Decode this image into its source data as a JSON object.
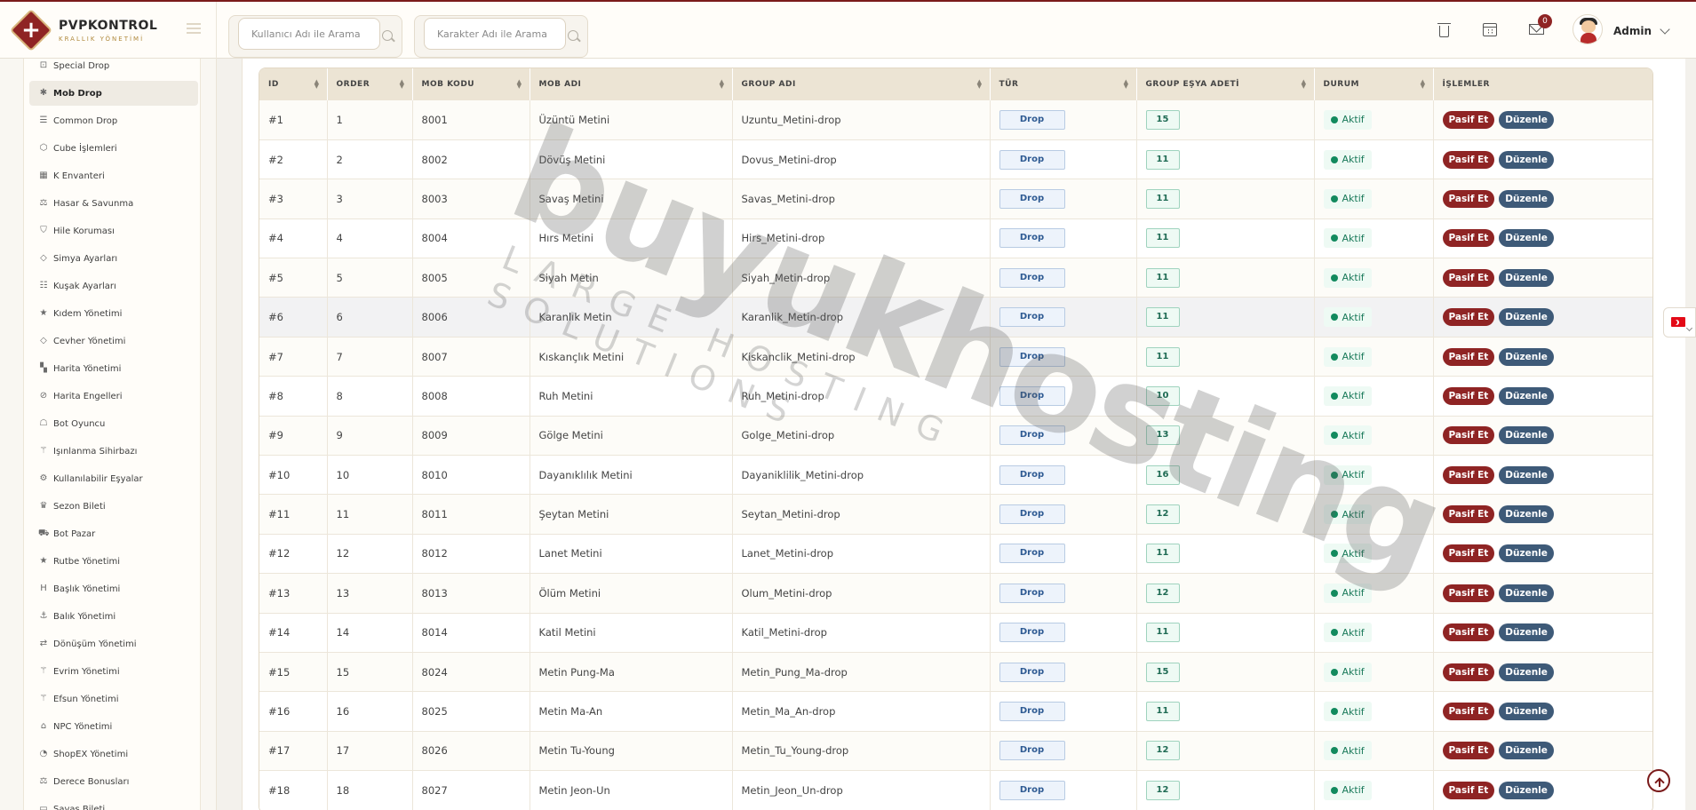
{
  "brand": {
    "title": "PVPKONTROL",
    "subtitle": "KRALLIK YÖNETİMİ"
  },
  "header": {
    "search_user_placeholder": "Kullanıcı Adı ile Arama",
    "search_char_placeholder": "Karakter Adı ile Arama",
    "notification_count": "0",
    "user_name": "Admin"
  },
  "sidebar": {
    "items": [
      {
        "label": "Special Drop",
        "icon": "gift-icon",
        "glyph": "⊡"
      },
      {
        "label": "Mob Drop",
        "icon": "bug-icon",
        "glyph": "✱",
        "active": true
      },
      {
        "label": "Common Drop",
        "icon": "list-icon",
        "glyph": "☰"
      },
      {
        "label": "Cube İşlemleri",
        "icon": "cube-icon",
        "glyph": "⬡"
      },
      {
        "label": "K Envanteri",
        "icon": "grid-icon",
        "glyph": "▦"
      },
      {
        "label": "Hasar & Savunma",
        "icon": "scale-icon",
        "glyph": "⚖"
      },
      {
        "label": "Hile Koruması",
        "icon": "shield-icon",
        "glyph": "⛉"
      },
      {
        "label": "Simya Ayarları",
        "icon": "gem-icon",
        "glyph": "◇"
      },
      {
        "label": "Kuşak Ayarları",
        "icon": "sliders-icon",
        "glyph": "☷"
      },
      {
        "label": "Kıdem Yönetimi",
        "icon": "star-icon",
        "glyph": "★"
      },
      {
        "label": "Cevher Yönetimi",
        "icon": "gem-icon",
        "glyph": "◇"
      },
      {
        "label": "Harita Yönetimi",
        "icon": "map-icon",
        "glyph": "▚"
      },
      {
        "label": "Harita Engelleri",
        "icon": "ban-icon",
        "glyph": "⊘"
      },
      {
        "label": "Bot Oyuncu",
        "icon": "robot-icon",
        "glyph": "☖"
      },
      {
        "label": "Işınlanma Sihirbazı",
        "icon": "wand-icon",
        "glyph": "⚚"
      },
      {
        "label": "Kullanılabilir Eşyalar",
        "icon": "gears-icon",
        "glyph": "⚙"
      },
      {
        "label": "Sezon Bileti",
        "icon": "trophy-icon",
        "glyph": "♛"
      },
      {
        "label": "Bot Pazar",
        "icon": "cart-icon",
        "glyph": "⛟"
      },
      {
        "label": "Rutbe Yönetimi",
        "icon": "star-icon",
        "glyph": "★"
      },
      {
        "label": "Başlık Yönetimi",
        "icon": "heading-icon",
        "glyph": "H"
      },
      {
        "label": "Balık Yönetimi",
        "icon": "anchor-icon",
        "glyph": "⚓"
      },
      {
        "label": "Dönüşüm Yönetimi",
        "icon": "shuffle-icon",
        "glyph": "⇄"
      },
      {
        "label": "Evrim Yönetimi",
        "icon": "wand-icon",
        "glyph": "⚚"
      },
      {
        "label": "Efsun Yönetimi",
        "icon": "wand-icon",
        "glyph": "⚚"
      },
      {
        "label": "NPC Yönetimi",
        "icon": "building-icon",
        "glyph": "⌂"
      },
      {
        "label": "ShopEX Yönetimi",
        "icon": "gauge-icon",
        "glyph": "◔"
      },
      {
        "label": "Derece Bonusları",
        "icon": "scale-icon",
        "glyph": "⚖"
      },
      {
        "label": "Savaş Bileti",
        "icon": "ticket-icon",
        "glyph": "▭"
      }
    ]
  },
  "table": {
    "columns": [
      "ID",
      "ORDER",
      "MOB KODU",
      "MOB ADI",
      "GROUP ADI",
      "TÜR",
      "GROUP EŞYA ADETİ",
      "DURUM",
      "İŞLEMLER"
    ],
    "action_pasif": "Pasif Et",
    "action_duzenle": "Düzenle",
    "rows": [
      {
        "id": "#1",
        "order": "1",
        "code": "8001",
        "name": "Üzüntü Metini",
        "group": "Uzuntu_Metini-drop",
        "type": "Drop",
        "count": "15",
        "status": "Aktif"
      },
      {
        "id": "#2",
        "order": "2",
        "code": "8002",
        "name": "Dövüş Metini",
        "group": "Dovus_Metini-drop",
        "type": "Drop",
        "count": "11",
        "status": "Aktif"
      },
      {
        "id": "#3",
        "order": "3",
        "code": "8003",
        "name": "Savaş Metini",
        "group": "Savas_Metini-drop",
        "type": "Drop",
        "count": "11",
        "status": "Aktif"
      },
      {
        "id": "#4",
        "order": "4",
        "code": "8004",
        "name": "Hırs Metini",
        "group": "Hirs_Metini-drop",
        "type": "Drop",
        "count": "11",
        "status": "Aktif"
      },
      {
        "id": "#5",
        "order": "5",
        "code": "8005",
        "name": "Siyah Metin",
        "group": "Siyah_Metin-drop",
        "type": "Drop",
        "count": "11",
        "status": "Aktif"
      },
      {
        "id": "#6",
        "order": "6",
        "code": "8006",
        "name": "Karanlık Metin",
        "group": "Karanlik_Metin-drop",
        "type": "Drop",
        "count": "11",
        "status": "Aktif"
      },
      {
        "id": "#7",
        "order": "7",
        "code": "8007",
        "name": "Kıskançlık Metini",
        "group": "Kiskanclik_Metini-drop",
        "type": "Drop",
        "count": "11",
        "status": "Aktif"
      },
      {
        "id": "#8",
        "order": "8",
        "code": "8008",
        "name": "Ruh Metini",
        "group": "Ruh_Metini-drop",
        "type": "Drop",
        "count": "10",
        "status": "Aktif"
      },
      {
        "id": "#9",
        "order": "9",
        "code": "8009",
        "name": "Gölge Metini",
        "group": "Golge_Metini-drop",
        "type": "Drop",
        "count": "13",
        "status": "Aktif"
      },
      {
        "id": "#10",
        "order": "10",
        "code": "8010",
        "name": "Dayanıklılık Metini",
        "group": "Dayaniklilik_Metini-drop",
        "type": "Drop",
        "count": "16",
        "status": "Aktif"
      },
      {
        "id": "#11",
        "order": "11",
        "code": "8011",
        "name": "Şeytan Metini",
        "group": "Seytan_Metini-drop",
        "type": "Drop",
        "count": "12",
        "status": "Aktif"
      },
      {
        "id": "#12",
        "order": "12",
        "code": "8012",
        "name": "Lanet Metini",
        "group": "Lanet_Metini-drop",
        "type": "Drop",
        "count": "11",
        "status": "Aktif"
      },
      {
        "id": "#13",
        "order": "13",
        "code": "8013",
        "name": "Ölüm Metini",
        "group": "Olum_Metini-drop",
        "type": "Drop",
        "count": "12",
        "status": "Aktif"
      },
      {
        "id": "#14",
        "order": "14",
        "code": "8014",
        "name": "Katil Metini",
        "group": "Katil_Metini-drop",
        "type": "Drop",
        "count": "11",
        "status": "Aktif"
      },
      {
        "id": "#15",
        "order": "15",
        "code": "8024",
        "name": "Metin Pung-Ma",
        "group": "Metin_Pung_Ma-drop",
        "type": "Drop",
        "count": "15",
        "status": "Aktif"
      },
      {
        "id": "#16",
        "order": "16",
        "code": "8025",
        "name": "Metin Ma-An",
        "group": "Metin_Ma_An-drop",
        "type": "Drop",
        "count": "11",
        "status": "Aktif"
      },
      {
        "id": "#17",
        "order": "17",
        "code": "8026",
        "name": "Metin Tu-Young",
        "group": "Metin_Tu_Young-drop",
        "type": "Drop",
        "count": "12",
        "status": "Aktif"
      },
      {
        "id": "#18",
        "order": "18",
        "code": "8027",
        "name": "Metin Jeon-Un",
        "group": "Metin_Jeon_Un-drop",
        "type": "Drop",
        "count": "12",
        "status": "Aktif"
      }
    ]
  },
  "watermark": {
    "main": "buyukhosting",
    "sub": "LARGE HOSTING SOLUTIONS"
  },
  "colors": {
    "brand_red": "#8f2424",
    "accent_gold": "#b08a3e",
    "status_green": "#128a5e",
    "edit_blue": "#3e5a78"
  }
}
